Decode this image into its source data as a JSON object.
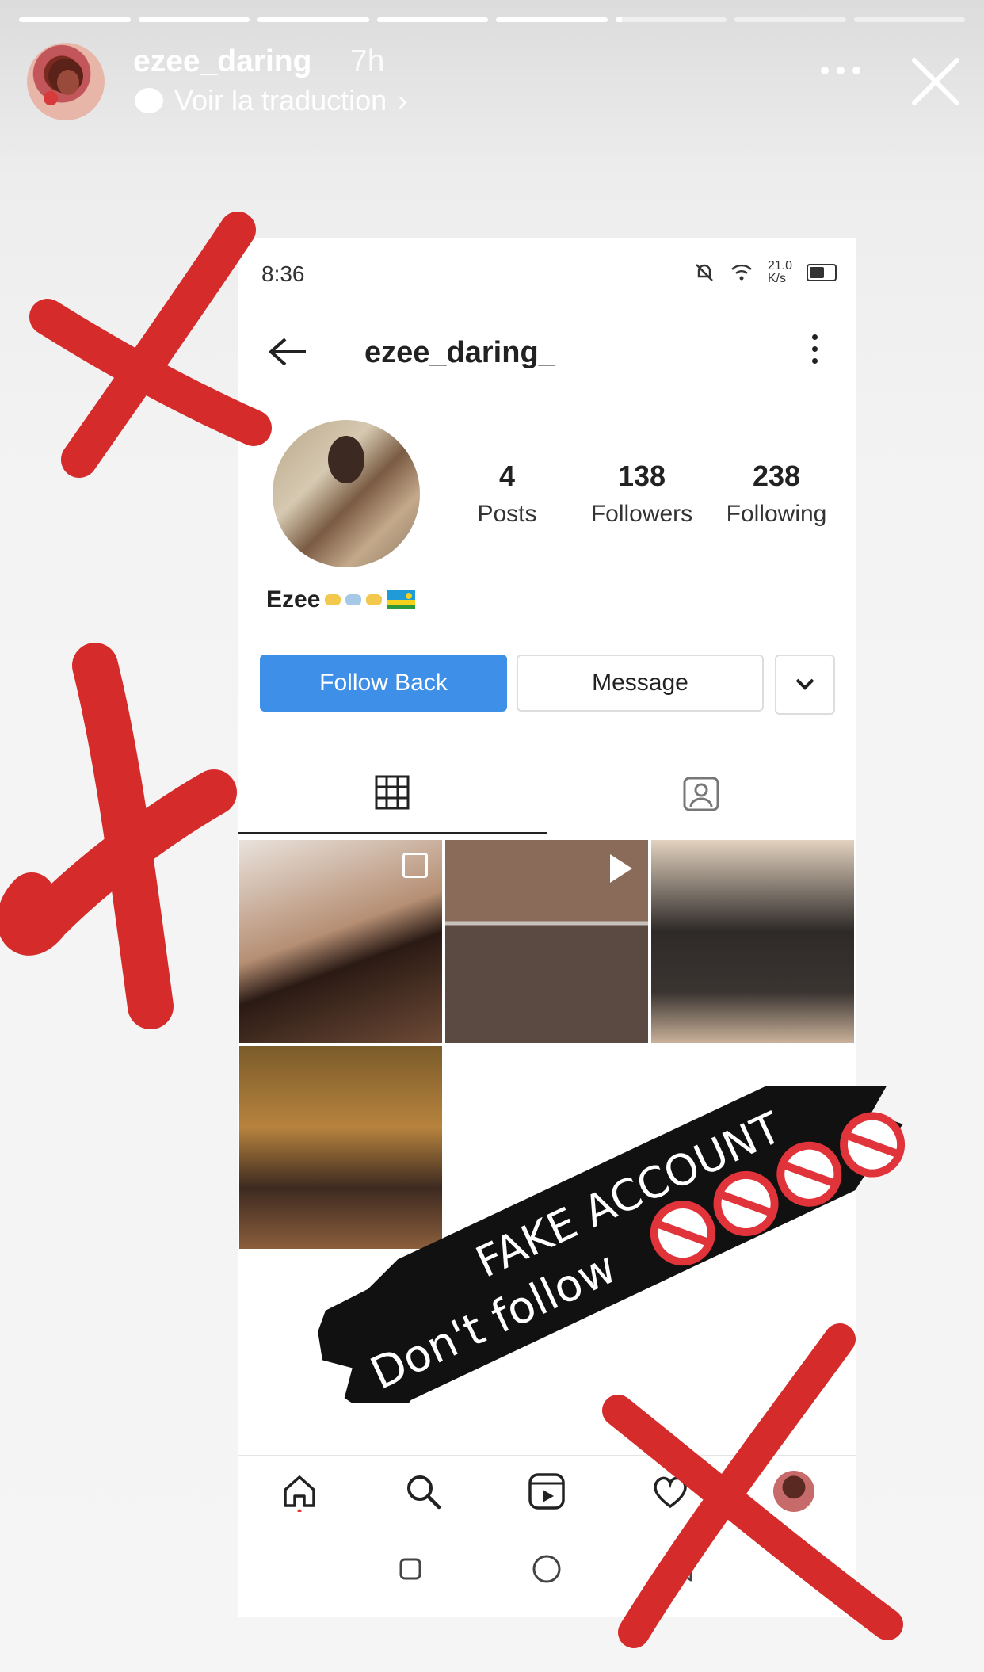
{
  "story": {
    "progress": [
      1,
      1,
      1,
      1,
      1,
      0.06,
      0,
      0
    ],
    "username": "ezee_daring",
    "time_ago": "7h",
    "translate_label": "Voir la traduction",
    "translate_chevron": "›"
  },
  "phone": {
    "status_time": "8:36",
    "network_speed": "21.0",
    "network_unit": "K/s",
    "profile": {
      "username": "ezee_daring_",
      "posts_count": "4",
      "posts_label": "Posts",
      "followers_count": "138",
      "followers_label": "Followers",
      "following_count": "238",
      "following_label": "Following",
      "bio_name": "Ezee"
    },
    "buttons": {
      "follow_back": "Follow Back",
      "message": "Message"
    }
  },
  "overlay": {
    "line1": "FAKE ACCOUNT",
    "line2": "Don't follow"
  },
  "colors": {
    "x_red": "#d52b2b",
    "follow_blue": "#3d8fe8",
    "stamp_black": "#111111"
  }
}
